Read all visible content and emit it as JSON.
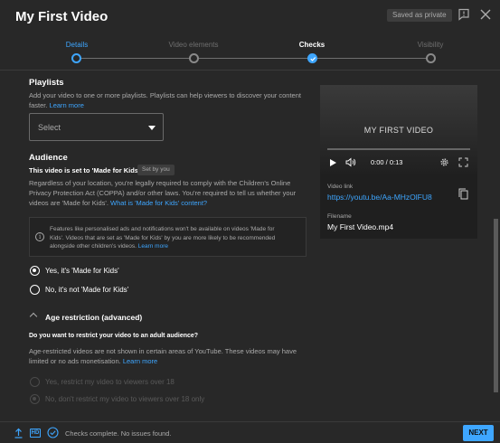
{
  "header": {
    "title": "My First Video",
    "saved_badge": "Saved as private"
  },
  "stepper": {
    "steps": [
      {
        "label": "Details",
        "state": "active"
      },
      {
        "label": "Video elements",
        "state": "inactive"
      },
      {
        "label": "Checks",
        "state": "done"
      },
      {
        "label": "Visibility",
        "state": "inactive"
      }
    ]
  },
  "playlists": {
    "heading": "Playlists",
    "desc_line1": "Add your video to one or more playlists. Playlists can help viewers to discover your content",
    "desc_line2": "faster.",
    "learn_more": "Learn more",
    "select_value": "Select"
  },
  "audience": {
    "heading": "Audience",
    "mfk_status": "This video is set to 'Made for Kids'",
    "set_by": "Set by you",
    "desc_line1": "Regardless of your location, you're legally required to comply with the Children's Online",
    "desc_line2": "Privacy Protection Act (COPPA) and/or other laws. You're required to tell us whether your",
    "desc_line3": "videos are 'Made for Kids'.",
    "whats_link": "What is 'Made for Kids' content?",
    "notice_line1": "Features like personalised ads and notifications won't be available on videos 'Made for",
    "notice_line2": "Kids'. Videos that are set as 'Made for Kids' by you are more likely to be recommended",
    "notice_line3": "alongside other children's videos.",
    "notice_link": "Learn more",
    "option_yes": "Yes, it's 'Made for Kids'",
    "option_no": "No, it's not 'Made for Kids'"
  },
  "age": {
    "toggle": "Age restriction (advanced)",
    "question": "Do you want to restrict your video to an adult audience?",
    "desc_line1": "Age-restricted videos are not shown in certain areas of YouTube. These videos may have",
    "desc_line2": "limited or no ads monetisation.",
    "learn_more": "Learn more",
    "option_yes": "Yes, restrict my video to viewers over 18",
    "option_no": "No, don't restrict my video to viewers over 18 only"
  },
  "video": {
    "thumb_title": "MY FIRST VIDEO",
    "time": "0:00 / 0:13",
    "progress": 0,
    "link_label": "Video link",
    "link": "https://youtu.be/Aa-MHzOlFU8",
    "filename_label": "Filename",
    "filename": "My First Video.mp4"
  },
  "footer": {
    "hd": "HD",
    "status": "Checks complete. No issues found.",
    "next": "NEXT"
  },
  "colors": {
    "accent": "#3ea6ff",
    "background": "#282828"
  }
}
